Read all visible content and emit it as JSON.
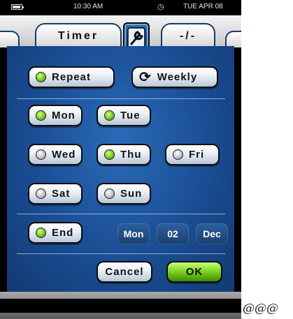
{
  "status_bar": {
    "time": "10:30 AM",
    "date": "TUE APR 08",
    "battery_icon": "battery-icon",
    "alarm_icon": "alarm-clock-icon"
  },
  "tabs": {
    "active": "Timer",
    "other": "-/-",
    "center_icon": "settings-wrench-icon"
  },
  "repeat": {
    "label": "Repeat",
    "on": true
  },
  "schedule_mode": {
    "label": "Weekly",
    "icon": "cycle-arrows-icon"
  },
  "days": [
    {
      "label": "Mon",
      "on": true
    },
    {
      "label": "Tue",
      "on": true
    },
    {
      "label": "Wed",
      "on": false
    },
    {
      "label": "Thu",
      "on": true
    },
    {
      "label": "Fri",
      "on": false
    },
    {
      "label": "Sat",
      "on": false
    },
    {
      "label": "Sun",
      "on": false
    }
  ],
  "end": {
    "label": "End",
    "on": true,
    "day": "Mon",
    "date": "02",
    "month": "Dec"
  },
  "actions": {
    "cancel": "Cancel",
    "ok": "OK"
  },
  "colors": {
    "panel_blue": "#1a4d93",
    "led_on": "#6ac21a",
    "ok_green": "#7ad11f"
  },
  "trailing_text": "@@@"
}
